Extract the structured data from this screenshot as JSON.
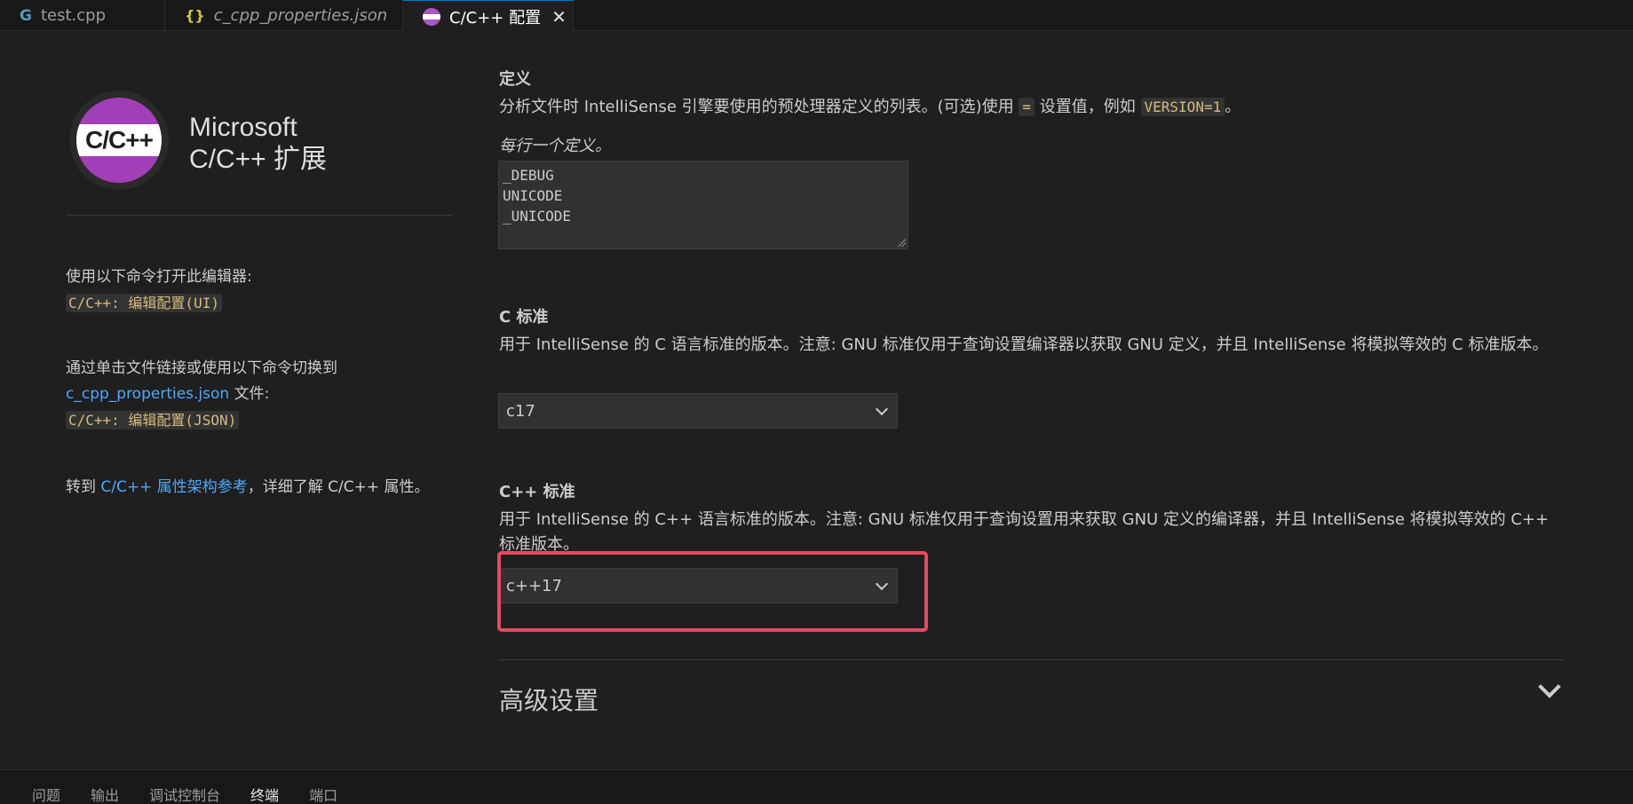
{
  "tabs": [
    {
      "label": "test.cpp",
      "icon": "cpp-file-icon"
    },
    {
      "label": "c_cpp_properties.json",
      "icon": "json-file-icon"
    },
    {
      "label": "C/C++ 配置",
      "icon": "cpp-extension-icon",
      "active": true
    }
  ],
  "brand": {
    "logo_text": "C/C++",
    "line1": "Microsoft",
    "line2": "C/C++ 扩展"
  },
  "left": {
    "open_editor_text": "使用以下命令打开此编辑器:",
    "open_editor_cmd": "C/C++: 编辑配置(UI)",
    "switch_text": "通过单击文件链接或使用以下命令切换到",
    "switch_link": "c_cpp_properties.json",
    "switch_suffix": " 文件:",
    "switch_cmd": "C/C++: 编辑配置(JSON)",
    "ref_prefix": "转到 ",
    "ref_link": "C/C++ 属性架构参考",
    "ref_suffix": "，详细了解 C/C++ 属性。"
  },
  "defines": {
    "title": "定义",
    "desc_part1": "分析文件时 IntelliSense 引擎要使用的预处理器定义的列表。(可选)使用 ",
    "desc_code1": "=",
    "desc_part2": " 设置值，例如 ",
    "desc_code2": "VERSION=1",
    "desc_part3": "。",
    "hint": "每行一个定义。",
    "values": [
      "_DEBUG",
      "UNICODE",
      "_UNICODE"
    ]
  },
  "c_standard": {
    "title": "C 标准",
    "desc": "用于 IntelliSense 的 C 语言标准的版本。注意: GNU 标准仅用于查询设置编译器以获取 GNU 定义，并且 IntelliSense 将模拟等效的 C 标准版本。",
    "value": "c17"
  },
  "cpp_standard": {
    "title": "C++ 标准",
    "desc": "用于 IntelliSense 的 C++ 语言标准的版本。注意: GNU 标准仅用于查询设置用来获取 GNU 定义的编译器，并且 IntelliSense 将模拟等效的 C++ 标准版本。",
    "value": "c++17"
  },
  "advanced": {
    "title": "高级设置"
  },
  "panel_tabs": [
    "问题",
    "输出",
    "调试控制台",
    "终端",
    "端口"
  ],
  "colors": {
    "accent_highlight": "#e64a63",
    "link": "#4daafc",
    "logo_purple": "#a23fb8"
  }
}
